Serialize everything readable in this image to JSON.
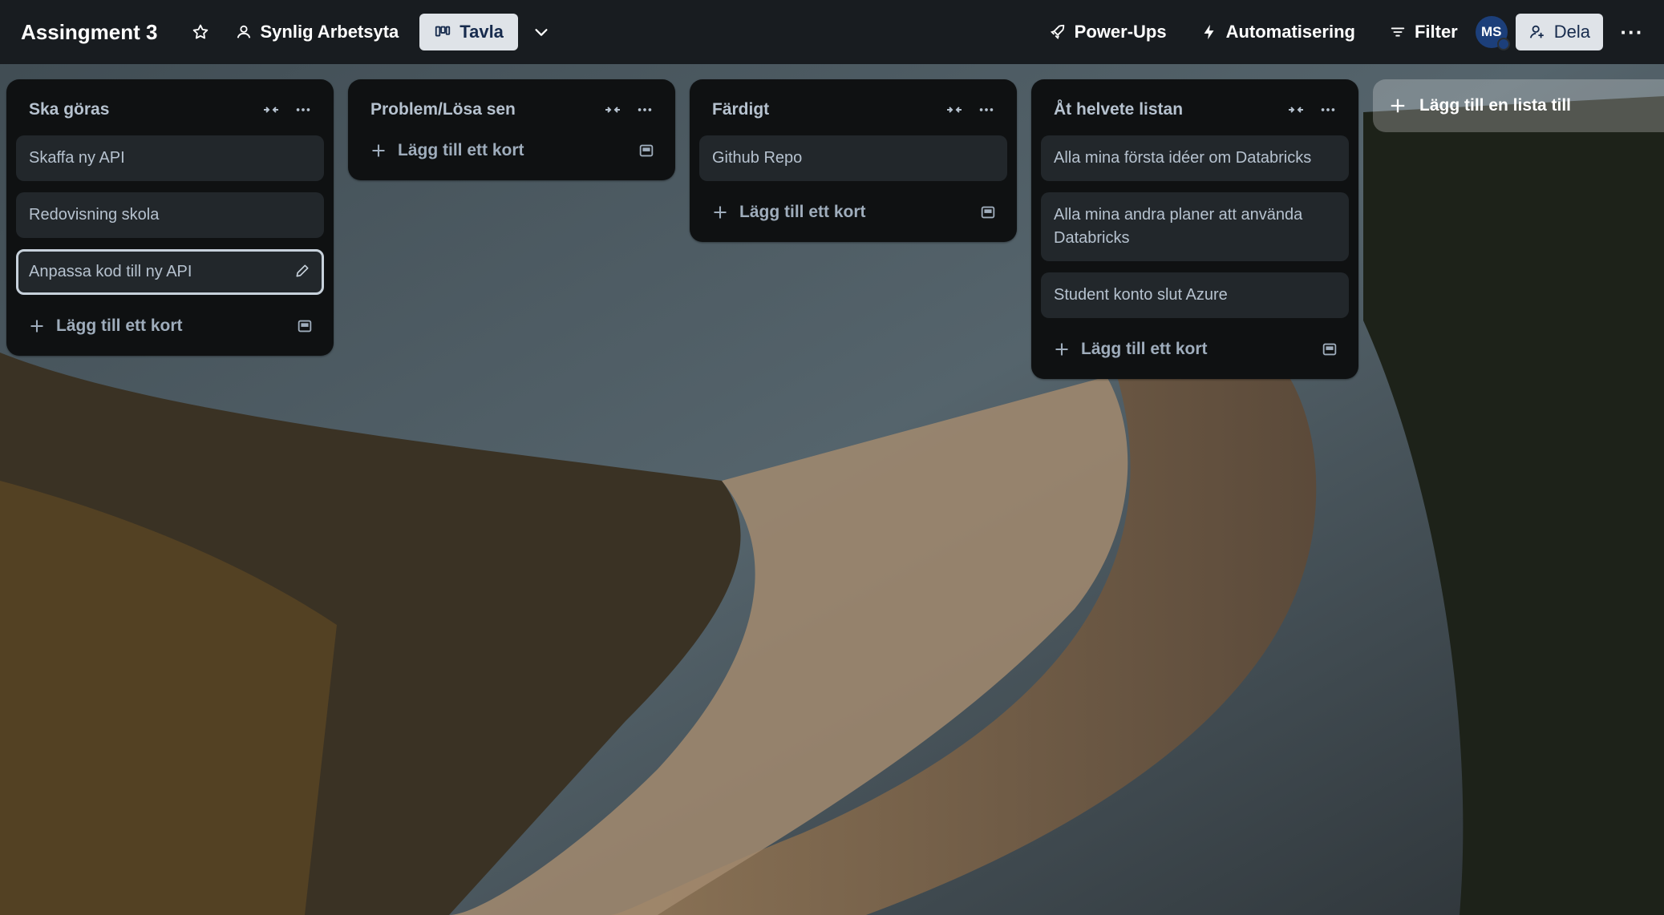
{
  "header": {
    "board_title": "Assingment 3",
    "visibility_label": "Synlig Arbetsyta",
    "view_label": "Tavla",
    "powerups_label": "Power-Ups",
    "automation_label": "Automatisering",
    "filter_label": "Filter",
    "avatar_initials": "MS",
    "share_label": "Dela",
    "more_label": "···"
  },
  "lists": [
    {
      "title": "Ska göras",
      "cards": [
        "Skaffa ny API",
        "Redovisning skola",
        "Anpassa kod till ny API"
      ],
      "add_card_label": "Lägg till ett kort"
    },
    {
      "title": "Problem/Lösa sen",
      "cards": [],
      "add_card_label": "Lägg till ett kort"
    },
    {
      "title": "Färdigt",
      "cards": [
        "Github Repo"
      ],
      "add_card_label": "Lägg till ett kort"
    },
    {
      "title": "Åt helvete listan",
      "cards": [
        "Alla mina första idéer om Databricks",
        "Alla mina andra planer att använda Databricks",
        "Student konto slut Azure"
      ],
      "add_card_label": "Lägg till ett kort"
    }
  ],
  "add_list_label": "Lägg till en lista till",
  "colors": {
    "list_bg": "#0f1112",
    "card_bg": "#22272b",
    "text": "#b6c2cf",
    "header_button_bg": "#dfe3e8",
    "avatar_bg": "#1c3f7a"
  },
  "icons": {
    "star": "star-icon",
    "visibility": "people-icon",
    "view": "board-icon",
    "chevron": "chevron-down-icon",
    "powerups": "rocket-icon",
    "automation": "lightning-icon",
    "filter": "filter-icon",
    "share": "add-person-icon",
    "collapse": "collapse-icon",
    "list_menu": "ellipsis-icon",
    "add": "plus-icon",
    "template": "template-icon",
    "edit": "pencil-icon"
  }
}
